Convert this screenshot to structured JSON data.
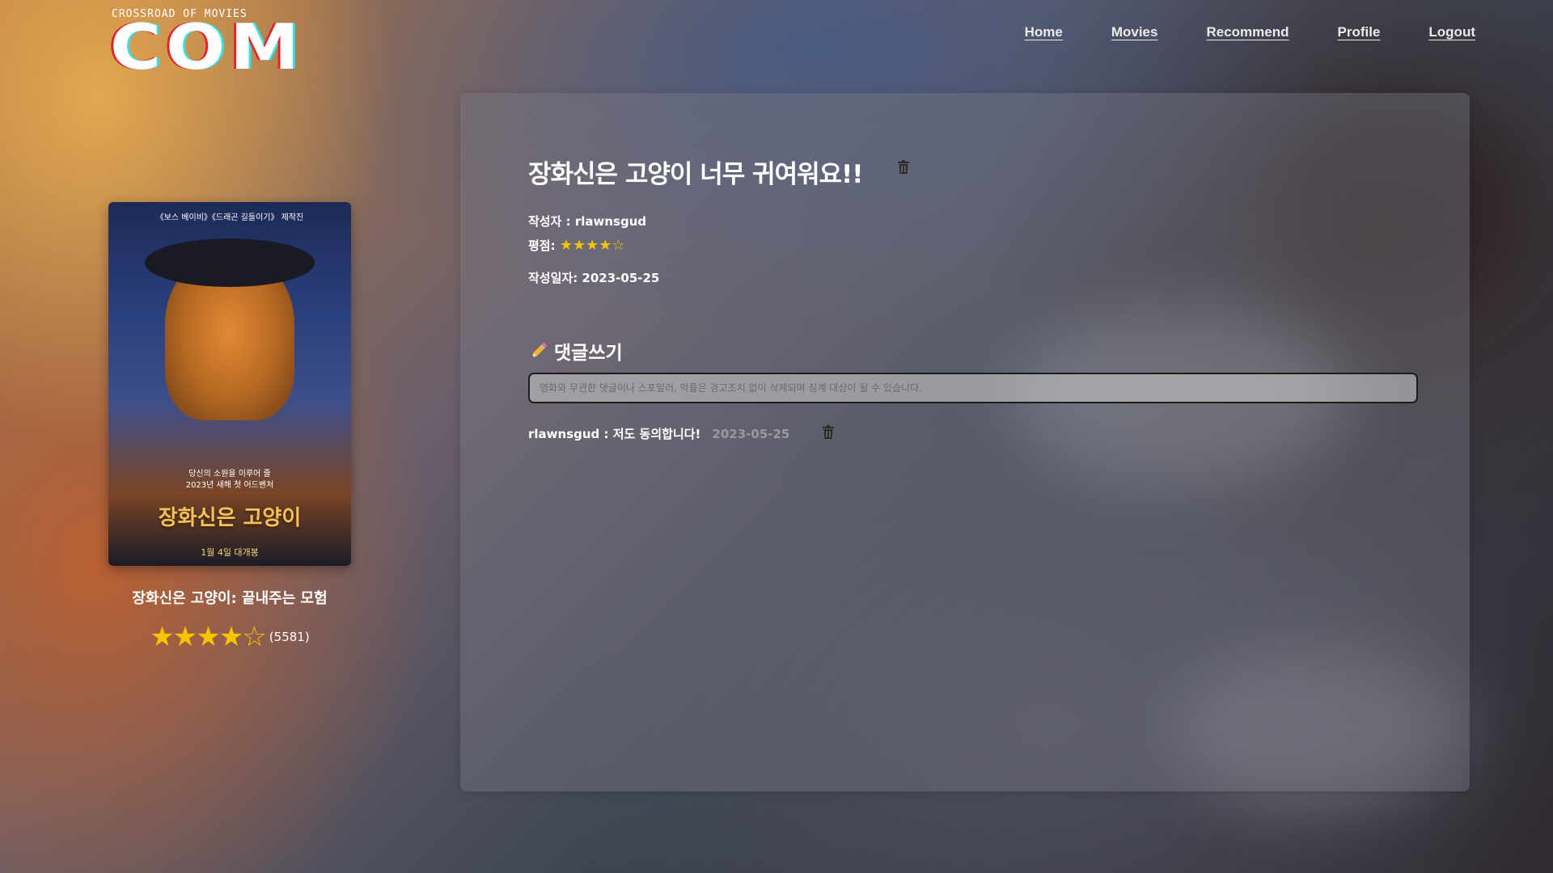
{
  "logo": {
    "subtitle": "CROSSROAD OF MOVIES",
    "main": "COM"
  },
  "nav": {
    "items": [
      "Home",
      "Movies",
      "Recommend",
      "Profile",
      "Logout"
    ]
  },
  "movie": {
    "poster_top_text": "《보스 베이비》《드래곤 길들이기》 제작진",
    "poster_mid_line1": "당신의 소원을 이루어 줄",
    "poster_mid_line2": "2023년 새해 첫 어드벤처",
    "poster_title": "장화신은 고양이",
    "poster_release": "1월 4일 대개봉",
    "title": "장화신은 고양이: 끝내주는 모험",
    "rating_stars": 4,
    "rating_max": 5,
    "rating_display": "★★★★☆",
    "vote_count": "(5581)"
  },
  "review": {
    "title": "장화신은 고양이 너무 귀여워요!!",
    "author_label": "작성자 : rlawnsgud",
    "score_label": "평점:",
    "score_stars": 4,
    "score_display": "★★★★☆",
    "date_label": "작성일자: 2023-05-25"
  },
  "comments": {
    "heading": "댓글쓰기",
    "placeholder": "영화와 무관한 댓글이나 스포일러, 악플은 경고조치 없이 삭제되며 징계 대상이 될 수 있습니다.",
    "items": [
      {
        "text": "rlawnsgud : 저도 동의합니다!",
        "date": "2023-05-25"
      }
    ]
  },
  "colors": {
    "star": "#f5c400",
    "panel": "rgba(120,120,130,0.42)",
    "logo_red": "#e0242b",
    "logo_cyan": "#35e0e6"
  },
  "icons": {
    "delete": "trash-icon",
    "write": "pencil-icon"
  }
}
